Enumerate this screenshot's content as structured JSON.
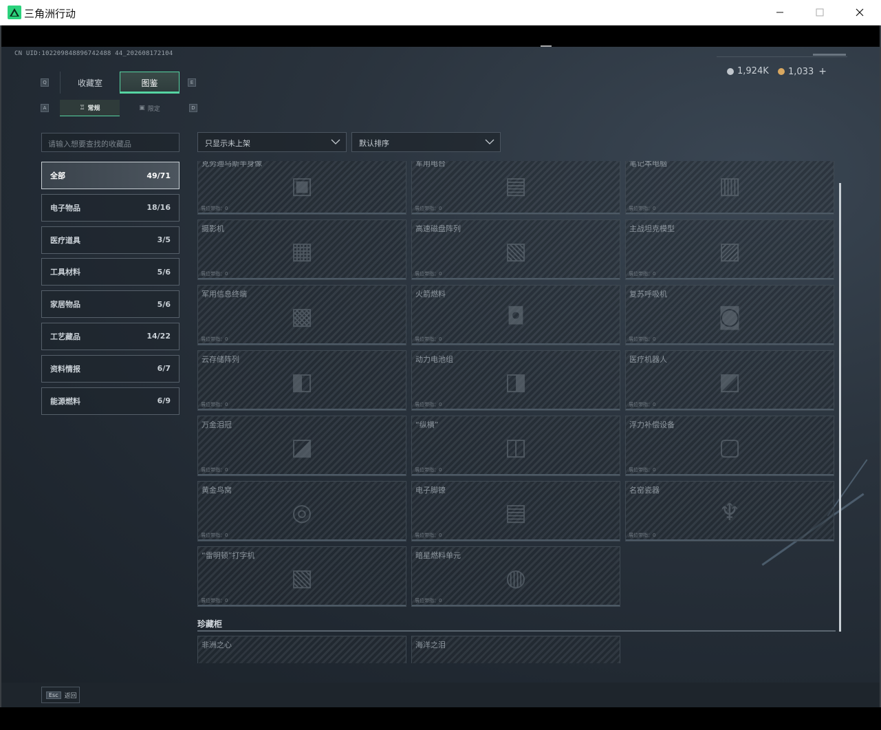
{
  "window": {
    "title": "三角洲行动"
  },
  "header": {
    "uid": "CN UID:102209848896742488 44_202608172104",
    "currency": [
      {
        "value": "1,924K",
        "color": "#c0c6cc"
      },
      {
        "value": "1,033",
        "plus": "+",
        "color": "#d9a860"
      }
    ]
  },
  "keys": {
    "left": "Q",
    "right": "E",
    "sub_left": "A",
    "sub_right": "D"
  },
  "tabs": [
    {
      "label": "收藏室",
      "active": false
    },
    {
      "label": "图鉴",
      "active": true
    }
  ],
  "subtabs": [
    {
      "label": "常规",
      "active": true
    },
    {
      "label": "限定",
      "active": false
    }
  ],
  "search": {
    "placeholder": "请输入想要查找的收藏品"
  },
  "filters": {
    "show": "只显示未上架",
    "sort": "默认排序"
  },
  "categories": [
    {
      "label": "全部",
      "count": "49/71",
      "active": true
    },
    {
      "label": "电子物品",
      "count": "18/16"
    },
    {
      "label": "医疗道具",
      "count": "3/5"
    },
    {
      "label": "工具材料",
      "count": "5/6"
    },
    {
      "label": "家居物品",
      "count": "5/6"
    },
    {
      "label": "工艺藏品",
      "count": "14/22"
    },
    {
      "label": "资料情报",
      "count": "6/7"
    },
    {
      "label": "能源燃料",
      "count": "6/9"
    }
  ],
  "card_slot_label": "展位带指：0",
  "items": [
    {
      "name": "克劳迪乌斯半身像"
    },
    {
      "name": "军用电台"
    },
    {
      "name": "笔记本电脑"
    },
    {
      "name": "摄影机"
    },
    {
      "name": "高速磁盘阵列"
    },
    {
      "name": "主战坦克模型"
    },
    {
      "name": "军用信息终端"
    },
    {
      "name": "火箭燃料"
    },
    {
      "name": "复苏呼吸机"
    },
    {
      "name": "云存储阵列"
    },
    {
      "name": "动力电池组"
    },
    {
      "name": "医疗机器人"
    },
    {
      "name": "万金泪冠"
    },
    {
      "name": "“纵横”"
    },
    {
      "name": "浮力补偿设备"
    },
    {
      "name": "黄金鸟窝"
    },
    {
      "name": "电子脚镣"
    },
    {
      "name": "名窑瓷器"
    },
    {
      "name": "“雷明顿”打字机"
    },
    {
      "name": "暗星燃料单元"
    }
  ],
  "section": {
    "title": "珍藏柜",
    "items": [
      {
        "name": "非洲之心"
      },
      {
        "name": "海洋之泪"
      }
    ]
  },
  "footer": {
    "esc_key": "Esc",
    "esc_label": "返回"
  },
  "colors": {
    "accent": "#56d5a2",
    "background": "#222a32"
  }
}
